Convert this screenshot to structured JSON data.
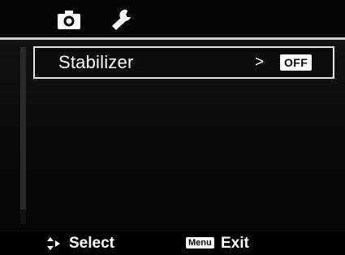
{
  "tabs": [
    {
      "icon": "camera-icon",
      "selected": true
    },
    {
      "icon": "wrench-icon",
      "selected": false
    }
  ],
  "menu": {
    "items": [
      {
        "label": "Stabilizer",
        "arrow": ">",
        "value": "OFF",
        "selected": true
      }
    ]
  },
  "footer": {
    "select_icon": "up-down-arrow-icon",
    "select_label": "Select",
    "menu_key": "Menu",
    "exit_label": "Exit"
  },
  "colors": {
    "background": "#000000",
    "text": "#ffffff",
    "selection_border": "#e5e5e5",
    "value_badge_bg": "#ffffff",
    "value_badge_text": "#000000"
  }
}
